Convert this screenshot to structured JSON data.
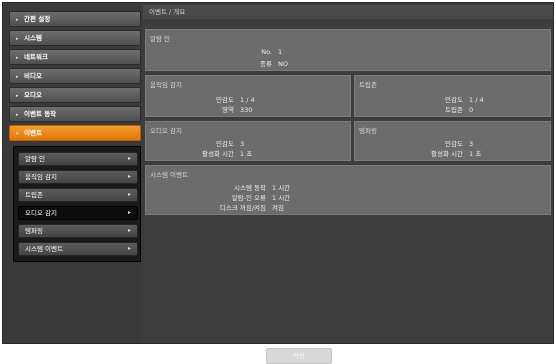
{
  "sidebar": {
    "items": [
      {
        "label": "간편 설정",
        "arrow": "▸"
      },
      {
        "label": "시스템",
        "arrow": "▸"
      },
      {
        "label": "네트워크",
        "arrow": "▸"
      },
      {
        "label": "비디오",
        "arrow": "▸"
      },
      {
        "label": "오디오",
        "arrow": "▸"
      },
      {
        "label": "이벤트 동작",
        "arrow": "▸"
      },
      {
        "label": "이벤트",
        "arrow": "▾"
      }
    ],
    "submenu": [
      {
        "label": "알람 인",
        "chevron": "▸"
      },
      {
        "label": "움직임 감지",
        "chevron": "▸"
      },
      {
        "label": "트립존",
        "chevron": "▸"
      },
      {
        "label": "오디오 감지",
        "chevron": "▸"
      },
      {
        "label": "템퍼링",
        "chevron": "▸"
      },
      {
        "label": "시스템 이벤트",
        "chevron": "▸"
      }
    ]
  },
  "breadcrumb": "이벤트 / 개요",
  "panels": {
    "alarm_in": {
      "title": "알람 인",
      "rows": [
        {
          "key": "No.",
          "value": "1"
        },
        {
          "key": "종류",
          "value": "NO"
        }
      ]
    },
    "motion": {
      "title": "움직임 감지",
      "rows": [
        {
          "key": "민감도",
          "value": "1 / 4"
        },
        {
          "key": "영역",
          "value": "330"
        }
      ]
    },
    "tripzone": {
      "title": "트립존",
      "rows": [
        {
          "key": "민감도",
          "value": "1 / 4"
        },
        {
          "key": "트립존",
          "value": "0"
        }
      ]
    },
    "audio": {
      "title": "오디오 감지",
      "rows": [
        {
          "key": "민감도",
          "value": "3"
        },
        {
          "key": "활성화 시간",
          "value": "1 초"
        }
      ]
    },
    "tampering": {
      "title": "템퍼링",
      "rows": [
        {
          "key": "민감도",
          "value": "3"
        },
        {
          "key": "활성화 시간",
          "value": "1 초"
        }
      ]
    },
    "system_event": {
      "title": "시스템 이벤트",
      "rows": [
        {
          "key": "시스템 동작",
          "value": "1 시간"
        },
        {
          "key": "알람-인 오류",
          "value": "1 시간"
        },
        {
          "key": "디스크 꺼짐/켜짐",
          "value": "켜짐"
        }
      ]
    }
  },
  "apply_label": "적용",
  "colors": {
    "active_menu": "#f0890f",
    "panel_bg": "#6c6c6c",
    "frame_bg": "#3b3b3b"
  }
}
